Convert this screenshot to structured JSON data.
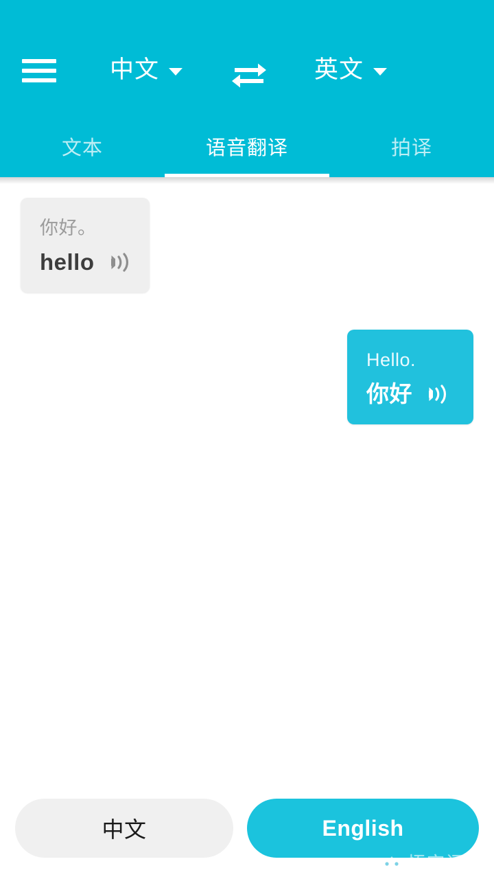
{
  "theme": {
    "brand": "#00bcd6",
    "bubble_outgoing": "#21c1dd",
    "bubble_incoming": "#efefef",
    "primary_button": "#1bc3dd",
    "secondary_button": "#f0f0f0"
  },
  "header": {
    "menu_icon": "hamburger-menu-icon",
    "source_language": "中文",
    "target_language": "英文",
    "swap_icon": "swap-horizontal-icon",
    "dropdown_icon": "chevron-down-icon"
  },
  "tabs": [
    {
      "label": "文本",
      "active": false
    },
    {
      "label": "语音翻译",
      "active": true
    },
    {
      "label": "拍译",
      "active": false
    }
  ],
  "conversation": [
    {
      "side": "incoming",
      "source_text": "你好。",
      "translated_text": "hello",
      "speaker_icon": "volume-speaker-icon"
    },
    {
      "side": "outgoing",
      "source_text": "Hello.",
      "translated_text": "你好",
      "speaker_icon": "volume-speaker-icon"
    }
  ],
  "bottom_bar": {
    "secondary_label": "中文",
    "primary_label": "English"
  },
  "watermark": {
    "text": "悟空问答",
    "logo_icon": "wukong-logo-icon"
  }
}
